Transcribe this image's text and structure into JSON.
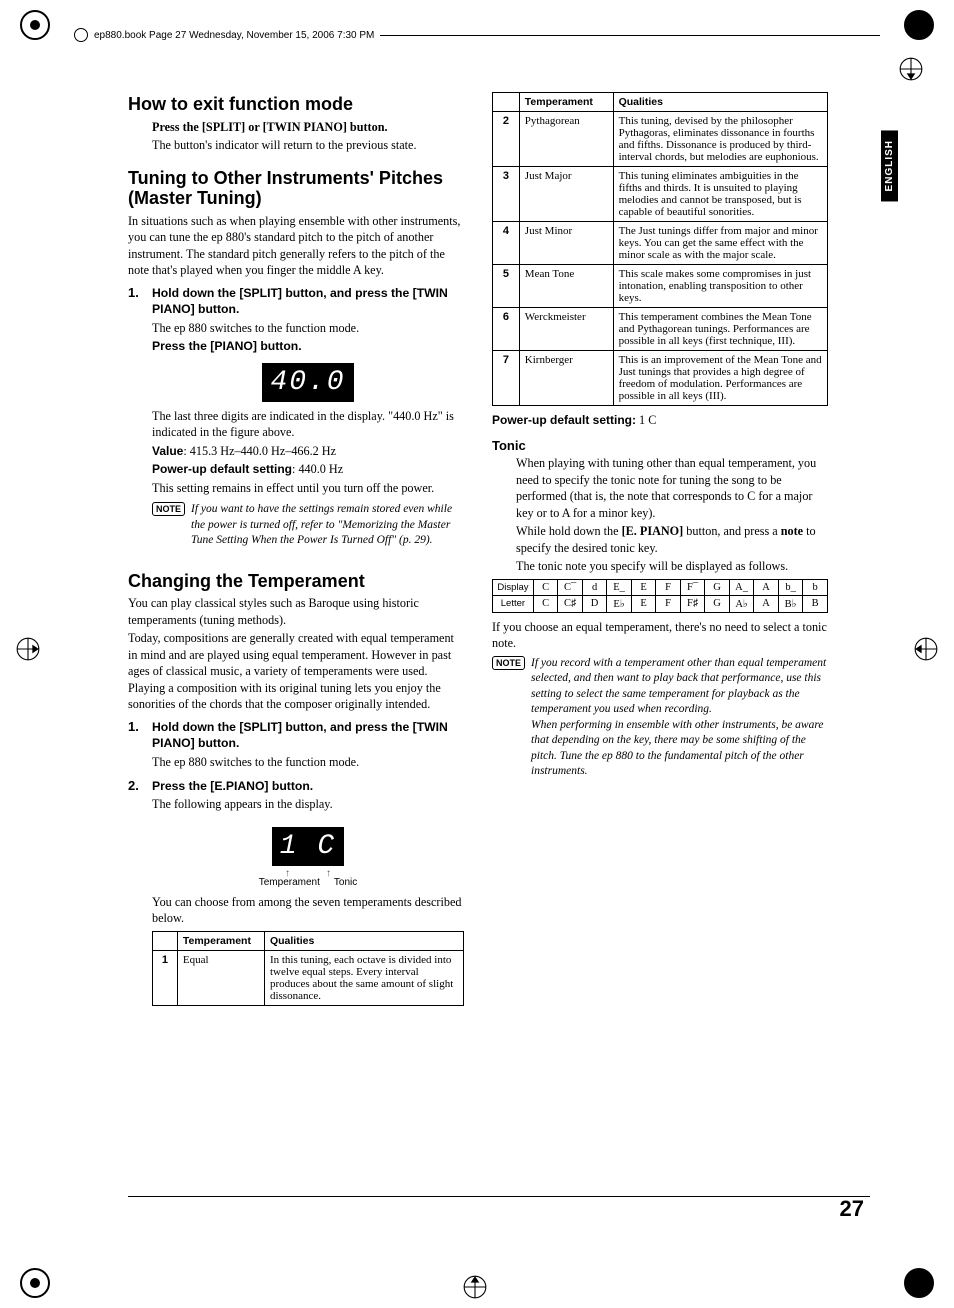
{
  "header": {
    "text": "ep880.book  Page 27  Wednesday, November 15, 2006  7:30 PM"
  },
  "side_tab": "ENGLISH",
  "page_number": "27",
  "sec1": {
    "title": "How to exit function mode",
    "p1_bold": "Press the [SPLIT] or [TWIN PIANO] button.",
    "p1": "The button's indicator will return to the previous state."
  },
  "sec2": {
    "title": "Tuning to Other Instruments' Pitches (Master Tuning)",
    "intro": "In situations such as when playing ensemble with other instruments, you can tune the ep 880's standard pitch to the pitch of another instrument. The standard pitch generally refers to the pitch of the note that's played when you finger the middle A key.",
    "step1_bold": "Hold down the [SPLIT] button, and press the [TWIN PIANO] button.",
    "step1_body": "The ep 880 switches to the function mode.",
    "step1_press": "Press the [PIANO] button.",
    "seg": "40.0",
    "after_seg1": "The last three digits are indicated in the display. \"440.0 Hz\" is indicated in the figure above.",
    "value_label": "Value",
    "value_text": ": 415.3 Hz–440.0 Hz–466.2 Hz",
    "pud_label": "Power-up default setting",
    "pud_text": ": 440.0 Hz",
    "remain": "This setting remains in effect until you turn off the power.",
    "note": "If you want to have the settings remain stored even while the power is turned off, refer to \"Memorizing the Master Tune Setting When the Power Is Turned Off\" (p. 29)."
  },
  "sec3": {
    "title": "Changing the Temperament",
    "p1": "You can play classical styles such as Baroque using historic temperaments (tuning methods).",
    "p2": "Today, compositions are generally created with equal temperament in mind and are played using equal temperament. However in past ages of classical music, a variety of temperaments were used. Playing a composition with its original tuning lets you enjoy the sonorities of the chords that the composer originally intended.",
    "step1_bold": "Hold down the [SPLIT] button, and press the [TWIN PIANO] button.",
    "step1_body": "The ep 880 switches to the function mode.",
    "step2_bold": "Press the [E.PIANO] button.",
    "step2_body": "The following appears in the display.",
    "seg": "1  C",
    "fig_labels": {
      "left": "Temperament",
      "right": "Tonic"
    },
    "after": "You can choose from among the seven temperaments described below.",
    "table1": {
      "headers": [
        "",
        "Temperament",
        "Qualities"
      ],
      "row": [
        "1",
        "Equal",
        "In this tuning, each octave is divided into twelve equal steps. Every interval produces about the same amount of slight dissonance."
      ]
    }
  },
  "table2": {
    "headers": [
      "",
      "Temperament",
      "Qualities"
    ],
    "rows": [
      [
        "2",
        "Pythagorean",
        "This tuning, devised by the philosopher Pythagoras, eliminates dissonance in fourths and fifths. Dissonance is produced by third-interval chords, but melodies are euphonious."
      ],
      [
        "3",
        "Just Major",
        "This tuning eliminates ambiguities in the fifths and thirds. It is unsuited to playing melodies and cannot be transposed, but is capable of beautiful sonorities."
      ],
      [
        "4",
        "Just Minor",
        "The Just tunings differ from major and minor keys. You can get the same effect with the minor scale as with the major scale."
      ],
      [
        "5",
        "Mean Tone",
        "This scale makes some compromises in just intonation, enabling transposition to other keys."
      ],
      [
        "6",
        "Werckmeister",
        "This temperament combines the Mean Tone and Pythagorean tunings. Performances are possible in all keys (first technique, III)."
      ],
      [
        "7",
        "Kirnberger",
        "This is an improvement of the Mean Tone and Just tunings that provides a high degree of freedom of modulation. Performances are possible in all keys (III)."
      ]
    ],
    "pud_label": "Power-up default setting:",
    "pud_val": " 1 C"
  },
  "tonic": {
    "title": "Tonic",
    "p1": "When playing with tuning other than equal temperament, you need to specify the tonic note for tuning the song to be performed (that is, the note that corresponds to C for a major key or to A for a minor key).",
    "p2a": "While hold down the ",
    "p2b": "[E. PIANO]",
    "p2c": " button, and press a ",
    "p2d": "note",
    "p2e": " to specify the desired tonic key.",
    "p3": "The tonic note you specify will be displayed as follows.",
    "table": {
      "row_display_label": "Display",
      "row_letter_label": "Letter",
      "display": [
        "C",
        "C¯",
        "d",
        "E_",
        "E",
        "F",
        "F¯",
        "G",
        "A_",
        "A",
        "b_",
        "b"
      ],
      "letter": [
        "C",
        "C♯",
        "D",
        "E♭",
        "E",
        "F",
        "F♯",
        "G",
        "A♭",
        "A",
        "B♭",
        "B"
      ]
    },
    "after": "If you choose an equal temperament, there's no need to select a tonic note.",
    "note": "If you record with a temperament other than equal temperament selected, and then want to play back that performance, use this setting to select the same temperament for playback as the temperament you used when recording.\nWhen performing in ensemble with other instruments, be aware that depending on the key, there may be some shifting of the pitch. Tune the ep 880 to the fundamental pitch of the other instruments."
  },
  "note_label": "NOTE"
}
